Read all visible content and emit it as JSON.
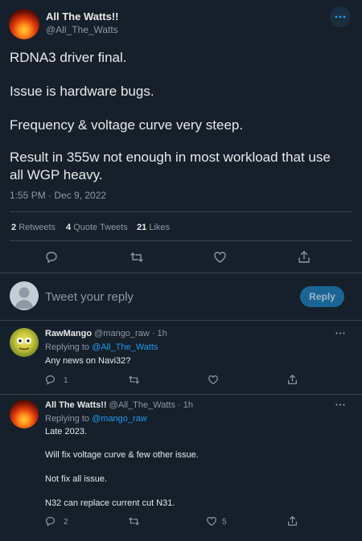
{
  "tweet": {
    "display_name": "All The Watts!!",
    "handle": "@All_The_Watts",
    "lines": [
      "RDNA3 driver final.",
      "Issue is hardware bugs.",
      "Frequency & voltage curve very steep.",
      "Result in 355w not enough in most workload that use",
      "all WGP heavy."
    ],
    "timestamp": "1:55 PM · Dec 9, 2022",
    "stats": {
      "retweets_count": "2",
      "retweets_label": "Retweets",
      "quotes_count": "4",
      "quotes_label": "Quote Tweets",
      "likes_count": "21",
      "likes_label": "Likes"
    }
  },
  "compose": {
    "placeholder": "Tweet your reply",
    "reply_button": "Reply"
  },
  "replies": [
    {
      "display_name": "RawMango",
      "handle_time": "@mango_raw · 1h",
      "replying_prefix": "Replying to",
      "replying_to": "@All_The_Watts",
      "lines": [
        "Any news on Navi32?"
      ],
      "reply_count": "1",
      "retweet_count": "",
      "like_count": ""
    },
    {
      "display_name": "All The Watts!!",
      "handle_time": "@All_The_Watts · 1h",
      "replying_prefix": "Replying to",
      "replying_to": "@mango_raw",
      "lines": [
        "Late 2023.",
        "Will fix voltage curve & few other issue.",
        "Not fix all issue.",
        "N32 can replace current cut N31."
      ],
      "reply_count": "2",
      "retweet_count": "",
      "like_count": "5"
    }
  ],
  "icons": {
    "more": "more-icon",
    "reply": "reply-icon",
    "retweet": "retweet-icon",
    "like": "like-icon",
    "share": "share-icon"
  },
  "colors": {
    "background": "#15202b",
    "text": "#e7e9ea",
    "muted": "#8b98a5",
    "accent": "#1d9bf0",
    "reply_button_bg": "#1a6596",
    "divider": "#38444d"
  }
}
